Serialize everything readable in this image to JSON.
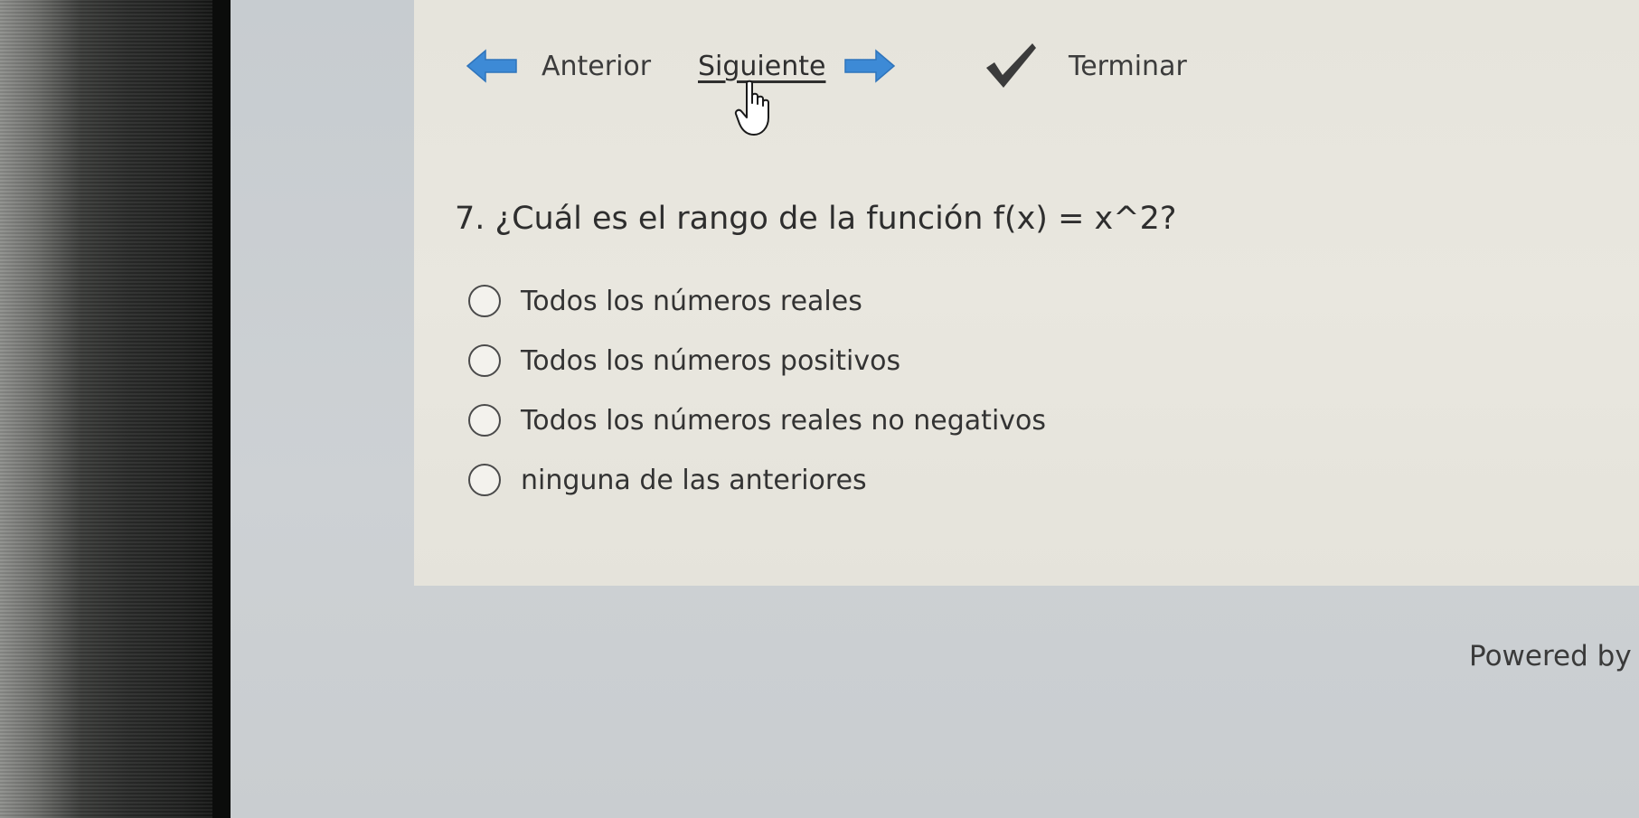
{
  "nav": {
    "prev_label": "Anterior",
    "next_label": "Siguiente",
    "finish_label": "Terminar",
    "arrow_color": "#3d8ad6",
    "check_color": "#3b3b3b",
    "prev_icon": "left-arrow-icon",
    "next_icon": "right-arrow-icon",
    "finish_icon": "checkmark-icon"
  },
  "question": {
    "text": "7. ¿Cuál es el rango de la función f(x) = x^2?",
    "options": [
      "Todos los números reales",
      "Todos los números positivos",
      "Todos los números reales no negativos",
      "ninguna de las anteriores"
    ]
  },
  "footer": {
    "text": "Powered by"
  }
}
